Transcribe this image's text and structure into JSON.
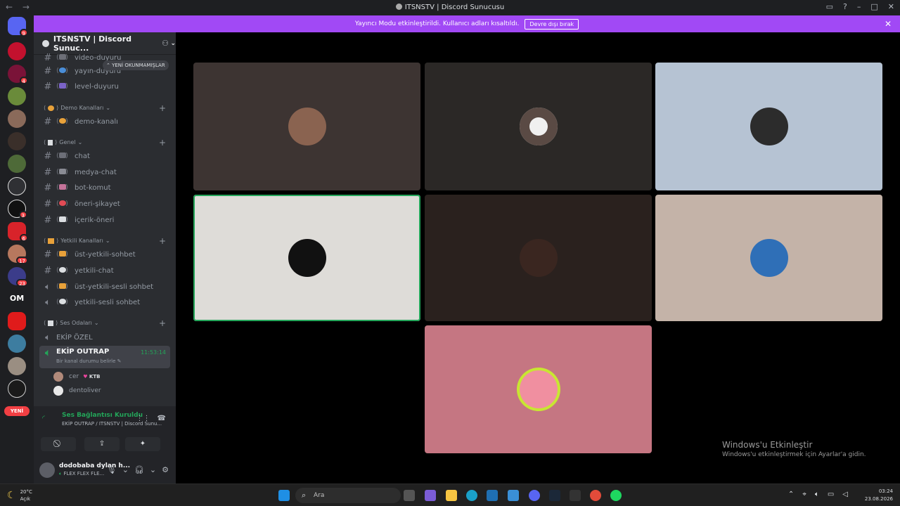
{
  "window": {
    "title": "ITSNSTV | Discord Sunucusu",
    "back_icon": "←",
    "forward_icon": "→"
  },
  "banner": {
    "text": "Yayıncı Modu etkinleştirildi. Kullanıcı adları kısaltıldı.",
    "button": "Devre dışı bırak"
  },
  "guilds": {
    "badges": [
      "9",
      "4",
      "3",
      "6",
      "17",
      "23"
    ],
    "om_label": "OM",
    "new_label": "YENİ"
  },
  "sidebar": {
    "server_name": "ITSNSTV | Discord Sunuc...",
    "unread_pill": "YENİ OKUNMAMIŞLAR",
    "top_channels": [
      "video-duyuru",
      "yayın-duyuru",
      "level-duyuru"
    ],
    "categories": {
      "demo": "Demo Kanalları",
      "genel": "Genel",
      "yetkili": "Yetkili Kanalları",
      "ses": "Ses Odaları"
    },
    "demo_channels": [
      "demo-kanalı"
    ],
    "genel_channels": [
      "chat",
      "medya-chat",
      "bot-komut",
      "öneri-şikayet",
      "içerik-öneri"
    ],
    "yetkili_channels": [
      "üst-yetkili-sohbet",
      "yetkili-chat",
      "üst-yetkili-sesli sohbet",
      "yetkili-sesli sohbet"
    ],
    "voice_channels": [
      "EKİP ÖZEL",
      "EKİP OUTRAP"
    ],
    "active_voice_timer": "11:53:14",
    "active_voice_status": "Bir kanal durumu belirle",
    "voice_users": [
      {
        "name": "cer",
        "tag": "KTB"
      },
      {
        "name": "dentoliver",
        "tag": ""
      }
    ]
  },
  "voice_panel": {
    "status": "Ses Bağlantısı Kuruldu",
    "location": "EKİP OUTRAP / ITSNSTV | Discord Sunu...",
    "username": "dodobaba dylan h...",
    "user_status": "FLEX FLEX FLE..."
  },
  "watermark": {
    "line1": "Windows'u Etkinleştir",
    "line2": "Windows'u etkinleştirmek için Ayarlar'a gidin."
  },
  "taskbar": {
    "temp": "20°C",
    "weather": "Açık",
    "search_placeholder": "Ara",
    "time": "03:24",
    "date": "23.08.2026"
  },
  "colors": {
    "banner": "#a149f5",
    "speaking": "#23a559",
    "sidebar": "#2b2d31",
    "tiles": [
      "#3d3432",
      "#2b2826",
      "#b6c3d3",
      "#dedcd8",
      "#2a211e",
      "#c4b3a8",
      "#c57682"
    ]
  }
}
